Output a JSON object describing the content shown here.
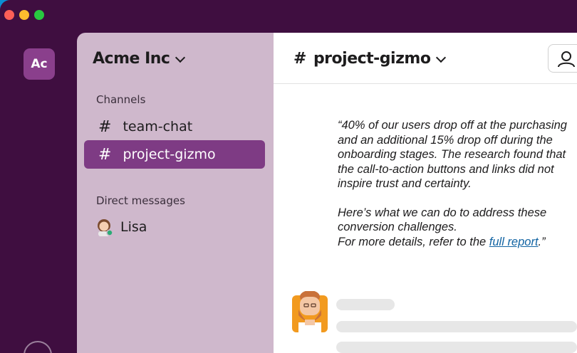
{
  "workspace": {
    "initials": "Ac",
    "name": "Acme Inc"
  },
  "sidebar": {
    "channels_label": "Channels",
    "channels": [
      {
        "label": "team-chat",
        "active": false
      },
      {
        "label": "project-gizmo",
        "active": true
      }
    ],
    "dm_label": "Direct messages",
    "dms": [
      {
        "label": "Lisa",
        "status": "online"
      }
    ]
  },
  "header": {
    "hash": "#",
    "channel": "project-gizmo"
  },
  "message": {
    "para1": "“40% of our users drop off at the purchasing and an additional 15% drop off during the onboarding stages. The research found that the call-to-action buttons and links did not inspire trust and certainty.",
    "para2a": "Here’s what we can do to address these conversion challenges.",
    "para2b_prefix": "For more details, refer to the ",
    "link": "full report",
    "para2b_suffix": ".”"
  },
  "colors": {
    "rail": "#3f0e40",
    "sidebar": "#cfb8cc",
    "active": "#7e3b84",
    "link": "#1264a3",
    "backdrop": "#0b8fd4"
  },
  "icons": [
    "chevron-down-icon",
    "hash-icon",
    "user-icon",
    "help-icon",
    "avatar-lisa",
    "avatar-bearded-man"
  ]
}
